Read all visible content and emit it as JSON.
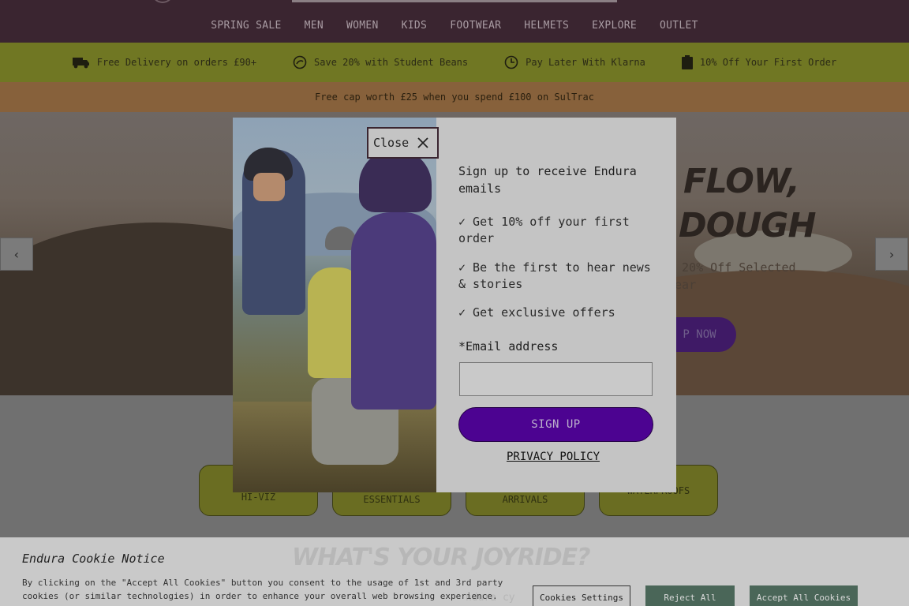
{
  "nav": {
    "links": [
      "SPRING SALE",
      "MEN",
      "WOMEN",
      "KIDS",
      "FOOTWEAR",
      "HELMETS",
      "EXPLORE",
      "OUTLET"
    ]
  },
  "promo": {
    "items": [
      {
        "icon": "truck-icon",
        "label": "Free Delivery on orders £90+"
      },
      {
        "icon": "student-beans-icon",
        "label": "Save 20% with Student Beans"
      },
      {
        "icon": "clock-icon",
        "label": "Pay Later With Klarna"
      },
      {
        "icon": "clipboard-icon",
        "label": "10% Off Your First Order"
      }
    ]
  },
  "announcement": "Free cap worth £25 when you spend £100 on SulTrac",
  "hero": {
    "headline_line1": "FLOW,",
    "headline_line2": "DOUGH",
    "subtext": "n 20% Off Selected wear",
    "cta": "P NOW",
    "prev": "‹",
    "next": "›"
  },
  "categories": [
    {
      "label": "R\nHI-VIZ"
    },
    {
      "label": "ESSENTIALS"
    },
    {
      "label": "ARRIVALS"
    },
    {
      "label": "WATERPROOFS"
    }
  ],
  "modal": {
    "close_label": "Close",
    "heading": "Sign up to receive Endura emails",
    "benefits": [
      "✓ Get 10% off your first order",
      "✓ Be the first to hear news & stories",
      "✓ Get exclusive offers"
    ],
    "email_label": "*Email address",
    "email_value": "",
    "signup_label": "SIGN UP",
    "privacy_label": "PRIVACY POLICY"
  },
  "cookie": {
    "title": "Endura Cookie Notice",
    "text": "By clicking on the \"Accept All Cookies\" button you consent to the usage of 1st and 3rd party cookies (or similar technologies) in order to enhance your overall web browsing experience.",
    "bg_heading": "WHAT'S YOUR JOYRIDE?",
    "bg_sub": "ndura cy",
    "settings_label": "Cookies Settings",
    "reject_label": "Reject All",
    "accept_label": "Accept All Cookies"
  }
}
